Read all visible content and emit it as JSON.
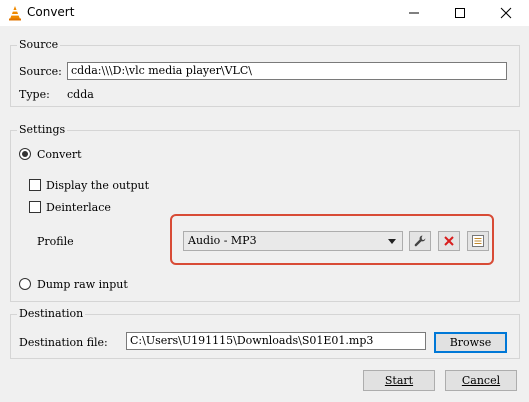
{
  "window": {
    "title": "Convert",
    "icon": "vlc-cone-icon"
  },
  "source": {
    "group_title": "Source",
    "source_label": "Source:",
    "source_value": "cdda:\\\\\\D:\\vlc media player\\VLC\\",
    "type_label": "Type:",
    "type_value": "cdda"
  },
  "settings": {
    "group_title": "Settings",
    "convert_label": "Convert",
    "convert_selected": true,
    "display_output_label": "Display the output",
    "display_output_checked": false,
    "deinterlace_label": "Deinterlace",
    "deinterlace_checked": false,
    "profile_label": "Profile",
    "profile_selected": "Audio - MP3",
    "dump_raw_label": "Dump raw input",
    "dump_raw_selected": false
  },
  "destination": {
    "group_title": "Destination",
    "file_label": "Destination file:",
    "file_value": "C:\\Users\\U191115\\Downloads\\S01E01.mp3",
    "browse_label": "Browse"
  },
  "footer": {
    "start_label": "Start",
    "cancel_label": "Cancel"
  },
  "icons": {
    "edit_profile": "wrench-icon",
    "delete_profile": "red-x-icon",
    "new_profile": "list-icon"
  },
  "colors": {
    "highlight": "#d84b36",
    "focus": "#0078d7"
  }
}
